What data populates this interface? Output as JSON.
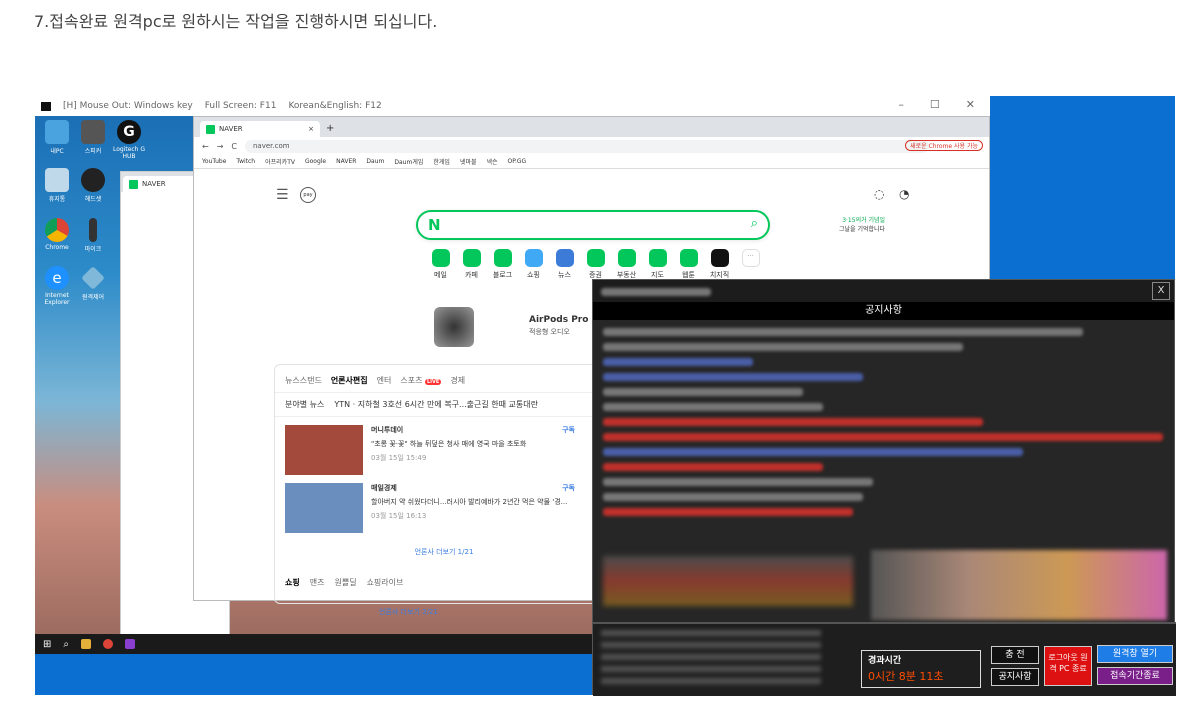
{
  "caption": "7.접속완료 원격pc로 원하시는 작업을 진행하시면 되십니다.",
  "remote_bar": {
    "mouse": "[H] Mouse Out: Windows key",
    "full": "Full Screen: F11",
    "lang": "Korean&English: F12",
    "min": "–",
    "max": "☐",
    "close": "✕"
  },
  "desktop_icons": [
    "내PC",
    "스피커",
    "Logitech G HUB",
    "휴지통",
    "헤드셋",
    "Chrome",
    "마이크",
    "Internet Explorer",
    "원격제어"
  ],
  "browser": {
    "tab": "NAVER",
    "url": "naver.com",
    "bookmarks": [
      "YouTube",
      "Twitch",
      "아프리카TV",
      "Google",
      "NAVER",
      "Daum",
      "Daum게임",
      "한게임",
      "넷마블",
      "넥슨",
      "OP.GG"
    ],
    "chrome_badge": "새로운 Chrome 사용 가능",
    "pay": "pay",
    "services": [
      "메일",
      "카페",
      "블로그",
      "쇼핑",
      "뉴스",
      "증권",
      "부동산",
      "지도",
      "웹툰",
      "치지직"
    ],
    "ad_title": "AirPods Pro",
    "ad_sub": "적응형 오디오",
    "side_note1": "3·15의거 기념일",
    "side_note2": "그날을 기억합니다",
    "news_tabs": [
      "뉴스스탠드",
      "언론사편집",
      "엔터",
      "스포츠",
      "경제"
    ],
    "live": "LIVE",
    "ticker_src": "분야별 뉴스",
    "ticker": "YTN · 지하철 3호선 6시간 만에 복구...출근길 한때 교통대란",
    "pager": "언론사 더보기 1/21",
    "pager2": "언론사 더보기 2/21",
    "shop_tabs": [
      "쇼핑",
      "맨즈",
      "원쁠딜",
      "쇼핑라이브"
    ],
    "articles": [
      {
        "src": "머니투데이",
        "sub": "구독",
        "text": "\"초롱 꽃·꽃\" 하늘 뒤덮은 청사 매에 영국 마을 초토화",
        "date": "03월 15일 15:49"
      },
      {
        "src": "매일경제",
        "sub": "구독",
        "text": "할아버지 약 쉬웠다더니...러시아 발리예바가 2년간 먹은 약물 '경...",
        "date": "03월 15일 16:13"
      }
    ]
  },
  "taskbar": [
    "⊞",
    "⌕"
  ],
  "notice": {
    "title": "공지사항",
    "close": "X",
    "elapsed_label": "경과시간",
    "elapsed_value": "0시간 8분 11초",
    "buttons": {
      "charge": "충 전",
      "notice": "공지사항",
      "logout": "로그아웃 원격 PC 종료",
      "open": "원격창 열기",
      "end": "접속기간종료"
    }
  }
}
